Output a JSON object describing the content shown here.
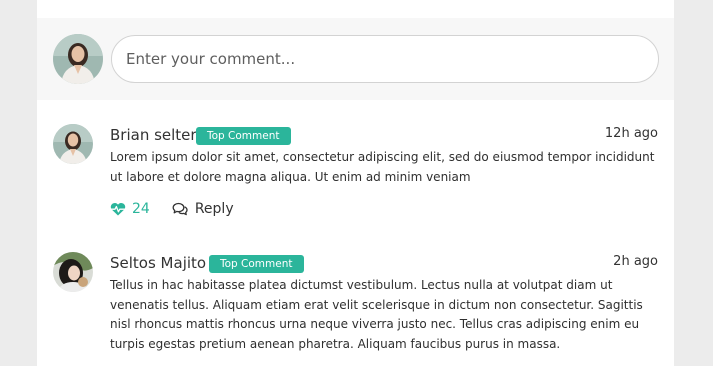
{
  "composer": {
    "placeholder": "Enter your comment..."
  },
  "comments": [
    {
      "author": "Brian selter",
      "badge": "Top Comment",
      "time": "12h ago",
      "body": "Lorem ipsum dolor sit amet, consectetur adipiscing elit, sed do eiusmod tempor incididunt ut labore et dolore magna aliqua. Ut enim ad minim veniam",
      "likes": "24",
      "reply_label": "Reply",
      "like_icon": "heart-pulse-icon",
      "reply_icon": "comments-icon"
    },
    {
      "author": "Seltos Majito",
      "badge": "Top Comment",
      "time": "2h ago",
      "body": "Tellus in hac habitasse platea dictumst vestibulum. Lectus nulla at volutpat diam ut venenatis tellus. Aliquam etiam erat velit scelerisque in dictum non consectetur. Sagittis nisl rhoncus mattis rhoncus urna neque viverra justo nec. Tellus cras adipiscing enim eu turpis egestas pretium aenean pharetra. Aliquam faucibus purus in massa."
    }
  ],
  "colors": {
    "accent": "#2bb59b",
    "page_bg": "#ececec",
    "composer_bg": "#f7f7f7",
    "text": "#2f2f2f"
  }
}
